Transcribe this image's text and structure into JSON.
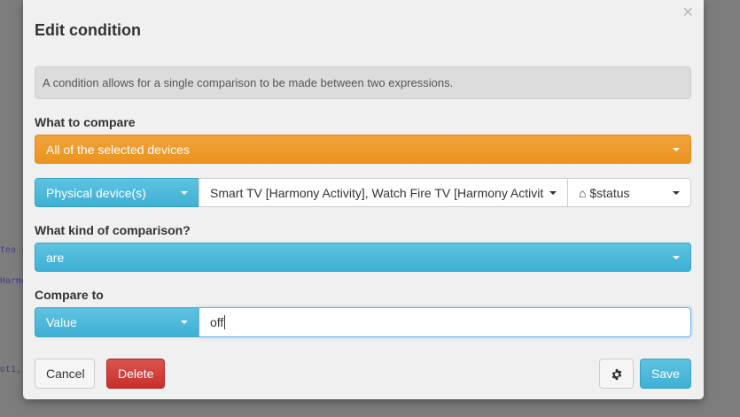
{
  "backdrop": {
    "line1": "tea s",
    "line2": "Harmo",
    "line3": "ot1,"
  },
  "modal": {
    "title": "Edit condition",
    "close_glyph": "×",
    "info": "A condition allows for a single comparison to be made between two expressions.",
    "compare_label": "What to compare",
    "compare_select": "All of the selected devices",
    "device_type": "Physical device(s)",
    "devices": "Smart TV [Harmony Activity], Watch Fire TV [Harmony Activit",
    "attribute_icon": "⌂",
    "attribute": "$status",
    "kind_label": "What kind of comparison?",
    "kind_select": "are",
    "compare_to_label": "Compare to",
    "value_type": "Value",
    "value_input": "off",
    "cancel": "Cancel",
    "delete": "Delete",
    "settings_icon": "gear-icon",
    "save": "Save"
  },
  "colors": {
    "orange": "#eb941e",
    "blue": "#3fb0d5",
    "red": "#c9302c"
  }
}
